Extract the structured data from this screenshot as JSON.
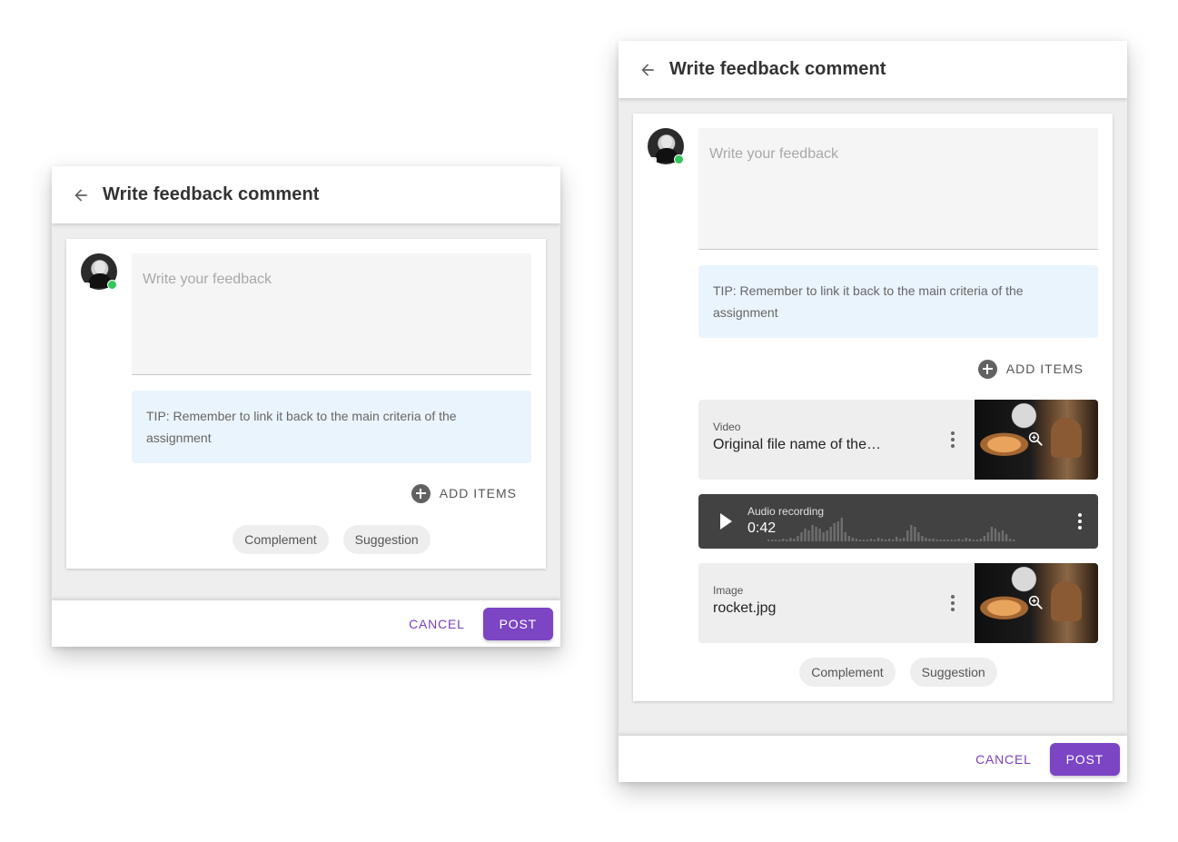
{
  "dialog_small": {
    "title": "Write feedback comment",
    "input_placeholder": "Write your feedback",
    "tip": "TIP: Remember to link it back to the main criteria of the assignment",
    "add_items_label": "ADD ITEMS",
    "chips": [
      "Complement",
      "Suggestion"
    ],
    "cancel_label": "CANCEL",
    "post_label": "POST"
  },
  "dialog_large": {
    "title": "Write feedback comment",
    "input_placeholder": "Write your feedback",
    "tip": "TIP: Remember to link it back to the main criteria of the assignment",
    "add_items_label": "ADD ITEMS",
    "attachments": {
      "video": {
        "type": "Video",
        "name": "Original file name of the…"
      },
      "audio": {
        "type": "Audio recording",
        "duration": "0:42"
      },
      "image": {
        "type": "Image",
        "name": "rocket.jpg"
      }
    },
    "chips": [
      "Complement",
      "Suggestion"
    ],
    "cancel_label": "CANCEL",
    "post_label": "POST"
  },
  "colors": {
    "accent": "#7b45c4",
    "tip_background": "#eaf4fd",
    "online_status": "#34c759",
    "audio_background": "#424242"
  },
  "icons": {
    "back": "arrow-back-icon",
    "add": "add-circle-icon",
    "more": "more-vert-icon",
    "play": "play-icon",
    "zoom": "zoom-in-icon"
  }
}
